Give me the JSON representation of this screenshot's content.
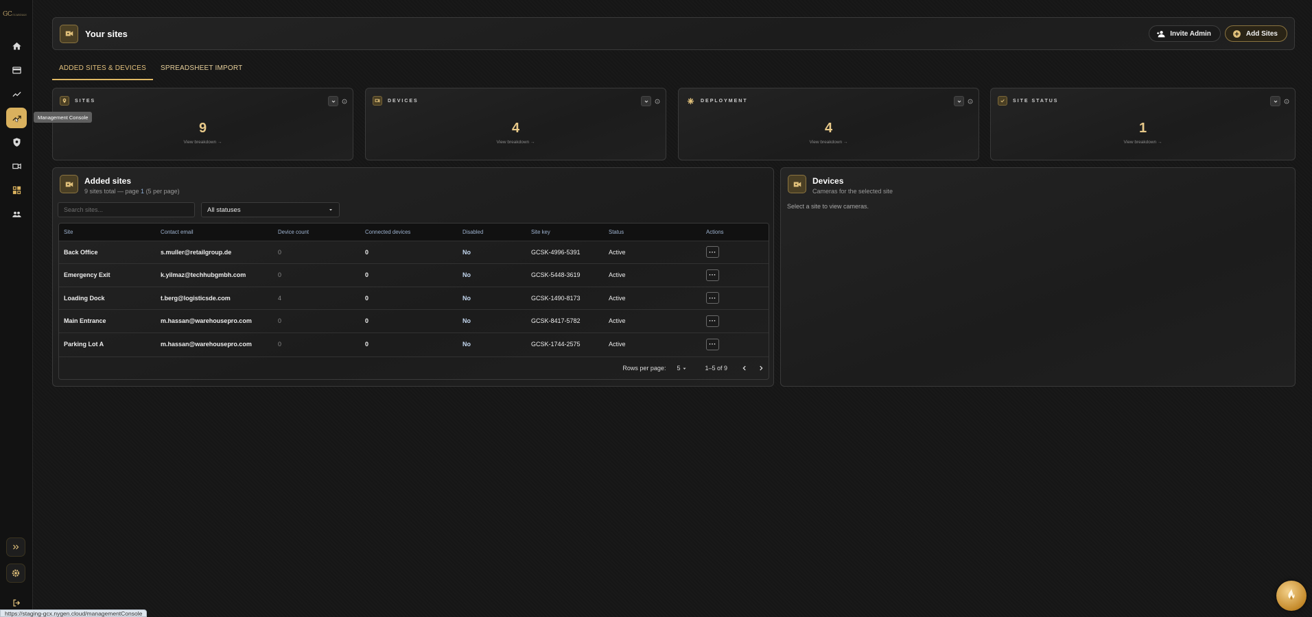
{
  "sidebar": {
    "logo": "GC",
    "logo_sub": "GUARDIAN",
    "tooltip": "Management Console",
    "items": [
      {
        "icon": "home-icon"
      },
      {
        "icon": "card-icon"
      },
      {
        "icon": "analytics-icon"
      },
      {
        "icon": "management-console-icon",
        "active": true
      },
      {
        "icon": "shield-icon"
      },
      {
        "icon": "video-camera-icon"
      },
      {
        "icon": "grid-icon"
      },
      {
        "icon": "users-icon"
      }
    ]
  },
  "header": {
    "title": "Your sites",
    "invite_label": "Invite Admin",
    "add_label": "Add Sites"
  },
  "tabs": [
    {
      "label": "ADDED SITES & DEVICES",
      "active": true
    },
    {
      "label": "SPREADSHEET IMPORT",
      "active": false
    }
  ],
  "stats": [
    {
      "label": "SITES",
      "value": "9",
      "link": "View breakdown →",
      "icon": "location-pin-icon"
    },
    {
      "label": "DEVICES",
      "value": "4",
      "link": "View breakdown →",
      "icon": "device-icon"
    },
    {
      "label": "DEPLOYMENT",
      "value": "4",
      "link": "View breakdown →",
      "icon": "deployment-icon"
    },
    {
      "label": "SITE STATUS",
      "value": "1",
      "link": "View breakdown →",
      "icon": "status-check-icon"
    }
  ],
  "sites": {
    "title": "Added sites",
    "subtitle_pre": "9 sites total — page ",
    "subtitle_page": "1",
    "subtitle_post": " (5 per page)",
    "search_placeholder": "Search sites...",
    "status_filter": "All statuses",
    "columns": [
      "Site",
      "Contact email",
      "Device count",
      "Connected devices",
      "Disabled",
      "Site key",
      "Status",
      "Actions"
    ],
    "rows": [
      {
        "site": "Back Office",
        "email": "s.muller@retailgroup.de",
        "device_count": "0",
        "connected": "0",
        "disabled": "No",
        "key": "GCSK-4996-5391",
        "status": "Active",
        "actions": "···"
      },
      {
        "site": "Emergency Exit",
        "email": "k.yilmaz@techhubgmbh.com",
        "device_count": "0",
        "connected": "0",
        "disabled": "No",
        "key": "GCSK-5448-3619",
        "status": "Active",
        "actions": "···"
      },
      {
        "site": "Loading Dock",
        "email": "t.berg@logisticsde.com",
        "device_count": "4",
        "connected": "0",
        "disabled": "No",
        "key": "GCSK-1490-8173",
        "status": "Active",
        "actions": "···"
      },
      {
        "site": "Main Entrance",
        "email": "m.hassan@warehousepro.com",
        "device_count": "0",
        "connected": "0",
        "disabled": "No",
        "key": "GCSK-8417-5782",
        "status": "Active",
        "actions": "···"
      },
      {
        "site": "Parking Lot A",
        "email": "m.hassan@warehousepro.com",
        "device_count": "0",
        "connected": "0",
        "disabled": "No",
        "key": "GCSK-1744-2575",
        "status": "Active",
        "actions": "···"
      }
    ],
    "pager": {
      "rows_label": "Rows per page:",
      "rows_value": "5",
      "range": "1–5 of 9"
    }
  },
  "devices": {
    "title": "Devices",
    "subtitle": "Cameras for the selected site",
    "empty_text": "Select a site to view cameras."
  },
  "status_url": "https://staging-gcx.nygen.cloud/managementConsole",
  "colors": {
    "accent": "#d9b15e",
    "background": "#161616",
    "panel_border": "#3a3a3a"
  }
}
